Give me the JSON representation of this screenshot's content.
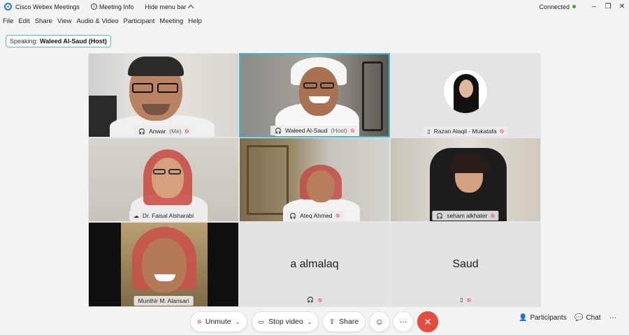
{
  "titlebar": {
    "app_title": "Cisco Webex Meetings",
    "info_label": "Meeting Info",
    "hide_label": "Hide menu bar",
    "status": "Connected",
    "minimize": "–",
    "restore": "❐",
    "close": "✕"
  },
  "menu": [
    "File",
    "Edit",
    "Share",
    "View",
    "Audio & Video",
    "Participant",
    "Meeting",
    "Help"
  ],
  "speaking": {
    "label": "Speaking:",
    "name": "Waleed Al-Saud (Host)"
  },
  "tiles": [
    {
      "name": "Anwar",
      "suffix": "(Me)"
    },
    {
      "name": "Waleed Al-Saud",
      "suffix": "(Host)"
    },
    {
      "name": "Razan Alaqil - Mukatafa",
      "suffix": ""
    },
    {
      "name": "Dr. Faisal Alsharabi",
      "suffix": ""
    },
    {
      "name": "Ateq Ahmed",
      "suffix": ""
    },
    {
      "name": "seham alkhater",
      "suffix": ""
    },
    {
      "name": "Munthir M. Alansari",
      "suffix": ""
    },
    {
      "name": "a almalaq",
      "suffix": ""
    },
    {
      "name": "Saud",
      "suffix": ""
    }
  ],
  "toolbar": {
    "unmute": "Unmute",
    "stop_video": "Stop video",
    "share": "Share",
    "participants": "Participants",
    "chat": "Chat"
  },
  "colors": {
    "accent": "#3fb6d8",
    "end_call": "#e84a3d",
    "connected": "#2eaa4a"
  }
}
